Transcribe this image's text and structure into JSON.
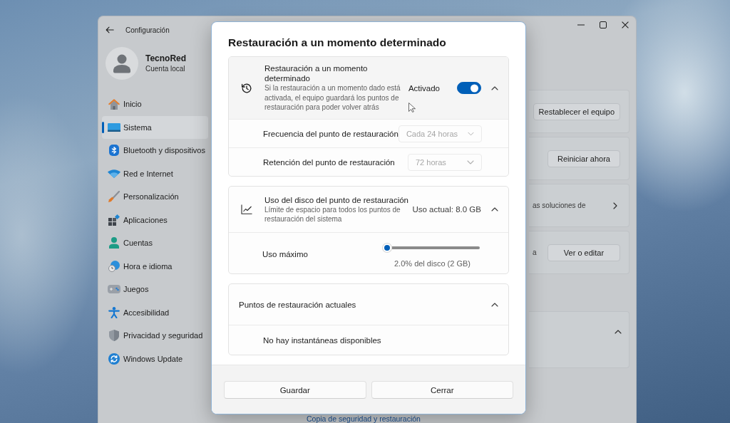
{
  "window": {
    "title": "Configuración"
  },
  "user": {
    "name": "TecnoRed",
    "account": "Cuenta local"
  },
  "sidebar": {
    "items": [
      {
        "label": "Inicio",
        "selected": false
      },
      {
        "label": "Sistema",
        "selected": true
      },
      {
        "label": "Bluetooth y dispositivos",
        "selected": false
      },
      {
        "label": "Red e Internet",
        "selected": false
      },
      {
        "label": "Personalización",
        "selected": false
      },
      {
        "label": "Aplicaciones",
        "selected": false
      },
      {
        "label": "Cuentas",
        "selected": false
      },
      {
        "label": "Hora e idioma",
        "selected": false
      },
      {
        "label": "Juegos",
        "selected": false
      },
      {
        "label": "Accesibilidad",
        "selected": false
      },
      {
        "label": "Privacidad y seguridad",
        "selected": false
      },
      {
        "label": "Windows Update",
        "selected": false
      }
    ]
  },
  "content": {
    "cards": [
      {
        "kind": "button",
        "button": "Restablecer el equipo"
      },
      {
        "kind": "button",
        "button": "Reiniciar ahora"
      },
      {
        "kind": "link",
        "text": "as soluciones de"
      },
      {
        "kind": "button",
        "text": "a",
        "button": "Ver o editar"
      },
      {
        "kind": "expander",
        "expanded": true
      }
    ],
    "link": "Copia de seguridad y restauración"
  },
  "dialog": {
    "title": "Restauración a un momento determinado",
    "sections": [
      {
        "kind": "toggle",
        "title": "Restauración a un momento determinado",
        "description": "Si la restauración a un momento dado está activada, el equipo guardará los puntos de restauración para poder volver atrás",
        "status": "Activado",
        "on": true,
        "expanded": true,
        "rows": [
          {
            "label": "Frecuencia del punto de restauración",
            "value": "Cada 24 horas",
            "disabled": true
          },
          {
            "label": "Retención del punto de restauración",
            "value": "72 horas",
            "disabled": true
          }
        ]
      },
      {
        "kind": "usage",
        "title": "Uso del disco del punto de restauración",
        "description": "Límite de espacio para todos los puntos de restauración del sistema",
        "reading": "Uso actual: 8.0 GB",
        "expanded": true,
        "slider": {
          "label": "Uso máximo",
          "level": 0.02,
          "reading": "2.0% del disco (2 GB)"
        }
      },
      {
        "kind": "list",
        "title": "Puntos de restauración actuales",
        "expanded": true,
        "empty_text": "No hay instantáneas disponibles"
      }
    ],
    "buttons": [
      "Guardar",
      "Cerrar"
    ]
  }
}
